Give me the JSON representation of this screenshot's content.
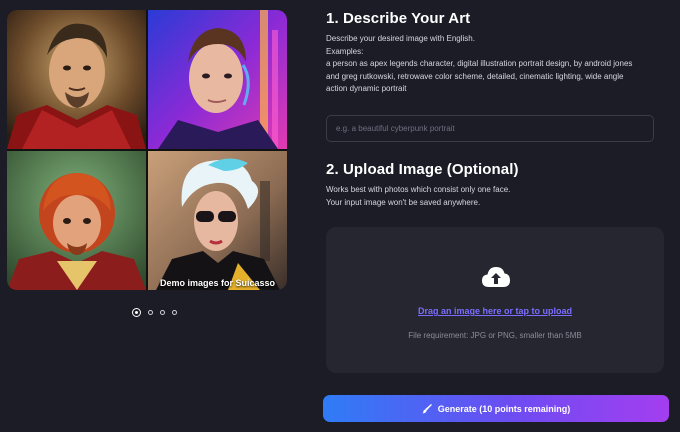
{
  "gallery": {
    "caption": "Demo images for Suicasso",
    "dots_count": 4,
    "active_dot": 0
  },
  "describe": {
    "heading": "1. Describe Your Art",
    "line1": "Describe your desired image with English.",
    "line2": "Examples:",
    "line3": "a person as apex legends character, digital illustration portrait design, by android jones",
    "line4": "and greg rutkowski, retrowave color scheme, detailed, cinematic lighting, wide angle",
    "line5": "action dynamic portrait",
    "input_placeholder": "e.g. a beautiful cyberpunk portrait",
    "input_value": ""
  },
  "upload": {
    "heading": "2. Upload Image (Optional)",
    "line1": "Works best with photos which consist only one face.",
    "line2": "Your input image won't be saved anywhere.",
    "drop_link": "Drag an image here or tap to upload",
    "requirement": "File requirement: JPG or PNG, smaller than 5MB",
    "icon": "cloud-upload-icon"
  },
  "generate": {
    "label": "Generate (10 points remaining)",
    "icon": "paintbrush-icon"
  },
  "colors": {
    "background": "#1b1c26",
    "panel": "#252630",
    "link": "#7b6dff",
    "button_gradient_start": "#2f7cf6",
    "button_gradient_end": "#a43ef0"
  }
}
